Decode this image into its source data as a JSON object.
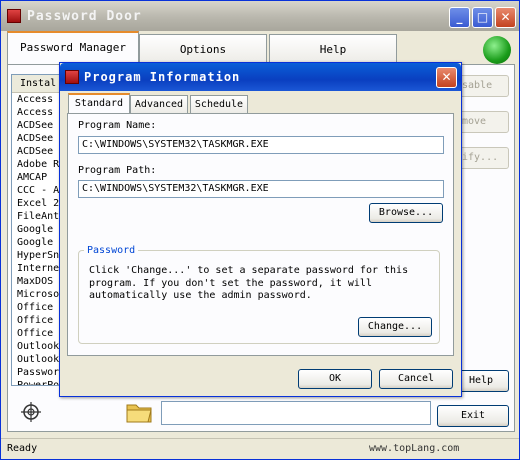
{
  "window": {
    "title": "Password Door"
  },
  "main_tabs": [
    {
      "label": "Password Manager"
    },
    {
      "label": "Options"
    },
    {
      "label": "Help"
    }
  ],
  "list": {
    "header": "Instal",
    "items": [
      "Access",
      "Access",
      "ACDSee",
      "ACDSee",
      "ACDSee",
      "Adobe R",
      "AMCAP",
      "CCC - A",
      "Excel 2",
      "FileAnt",
      "Google",
      "Google",
      "HyperSn",
      "Interne",
      "MaxDOS",
      "Microso",
      "Office",
      "Office",
      "Office",
      "Outlook",
      "Outlook",
      "Passwor",
      "PowerPo"
    ]
  },
  "side_buttons": {
    "disable": "sable",
    "remove": "move",
    "modify": "ify..."
  },
  "help_label": "Help",
  "exit_label": "Exit",
  "status": {
    "left": "Ready",
    "right": "www.topLang.com"
  },
  "dialog": {
    "title": "Program Information",
    "tabs": [
      {
        "label": "Standard"
      },
      {
        "label": "Advanced"
      },
      {
        "label": "Schedule"
      }
    ],
    "program_name_label": "Program Name:",
    "program_name_value": "C:\\WINDOWS\\SYSTEM32\\TASKMGR.EXE",
    "program_path_label": "Program Path:",
    "program_path_value": "C:\\WINDOWS\\SYSTEM32\\TASKMGR.EXE",
    "browse_label": "Browse...",
    "password_group_title": "Password",
    "password_text": "Click 'Change...' to set a separate password for this program. If you don't set the password, it will automatically use the admin password.",
    "change_label": "Change...",
    "ok_label": "OK",
    "cancel_label": "Cancel"
  }
}
